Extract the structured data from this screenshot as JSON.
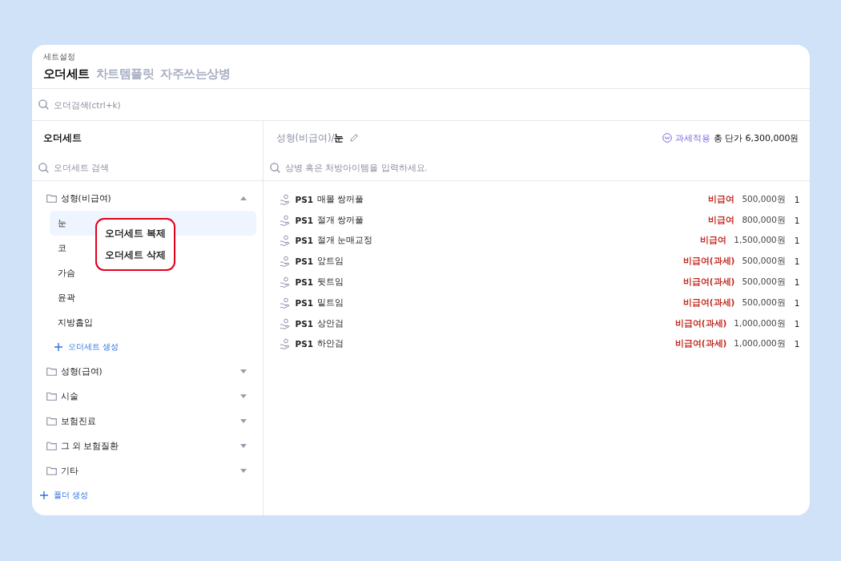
{
  "breadcrumb": "세트설정",
  "tabs": [
    {
      "label": "오더세트",
      "selected": true
    },
    {
      "label": "차트템플릿",
      "selected": false
    },
    {
      "label": "자주쓰는상병",
      "selected": false
    }
  ],
  "order_search": {
    "placeholder": "오더검색(ctrl+k)"
  },
  "sidebar": {
    "title": "오더세트",
    "search": {
      "placeholder": "오더세트 검색"
    },
    "folders": [
      {
        "label": "성형(비급여)",
        "expanded": true,
        "add_label": "오더세트 생성",
        "children": [
          {
            "label": "눈",
            "selected": true
          },
          {
            "label": "코",
            "selected": false
          },
          {
            "label": "가슴",
            "selected": false
          },
          {
            "label": "윤곽",
            "selected": false
          },
          {
            "label": "지방흡입",
            "selected": false
          }
        ]
      },
      {
        "label": "성형(급여)",
        "expanded": false
      },
      {
        "label": "시술",
        "expanded": false
      },
      {
        "label": "보험진료",
        "expanded": false
      },
      {
        "label": "그 외 보험질환",
        "expanded": false
      },
      {
        "label": "기타",
        "expanded": false
      }
    ],
    "add_folder": "폴더 생성"
  },
  "context_menu": {
    "items": [
      "오더세트 복제",
      "오더세트 삭제"
    ]
  },
  "detail": {
    "path": "성형(비급여)/**눈**",
    "tax_label": "과세적용",
    "total": "총 단가 6,300,000원",
    "search": {
      "placeholder": "상병 혹은 처방아이템을 입력하세요."
    },
    "items": [
      {
        "code": "PS1",
        "name": "매몰 쌍꺼풀",
        "category": "비급여",
        "price": "500,000원",
        "qty": "1"
      },
      {
        "code": "PS1",
        "name": "절개 쌍꺼풀",
        "category": "비급여",
        "price": "800,000원",
        "qty": "1"
      },
      {
        "code": "PS1",
        "name": "절개 눈매교정",
        "category": "비급여",
        "price": "1,500,000원",
        "qty": "1"
      },
      {
        "code": "PS1",
        "name": "앞트임",
        "category": "비급여(과세)",
        "price": "500,000원",
        "qty": "1"
      },
      {
        "code": "PS1",
        "name": "뒷트임",
        "category": "비급여(과세)",
        "price": "500,000원",
        "qty": "1"
      },
      {
        "code": "PS1",
        "name": "밑트임",
        "category": "비급여(과세)",
        "price": "500,000원",
        "qty": "1"
      },
      {
        "code": "PS1",
        "name": "상안검",
        "category": "비급여(과세)",
        "price": "1,000,000원",
        "qty": "1"
      },
      {
        "code": "PS1",
        "name": "하안검",
        "category": "비급여(과세)",
        "price": "1,000,000원",
        "qty": "1"
      }
    ]
  }
}
